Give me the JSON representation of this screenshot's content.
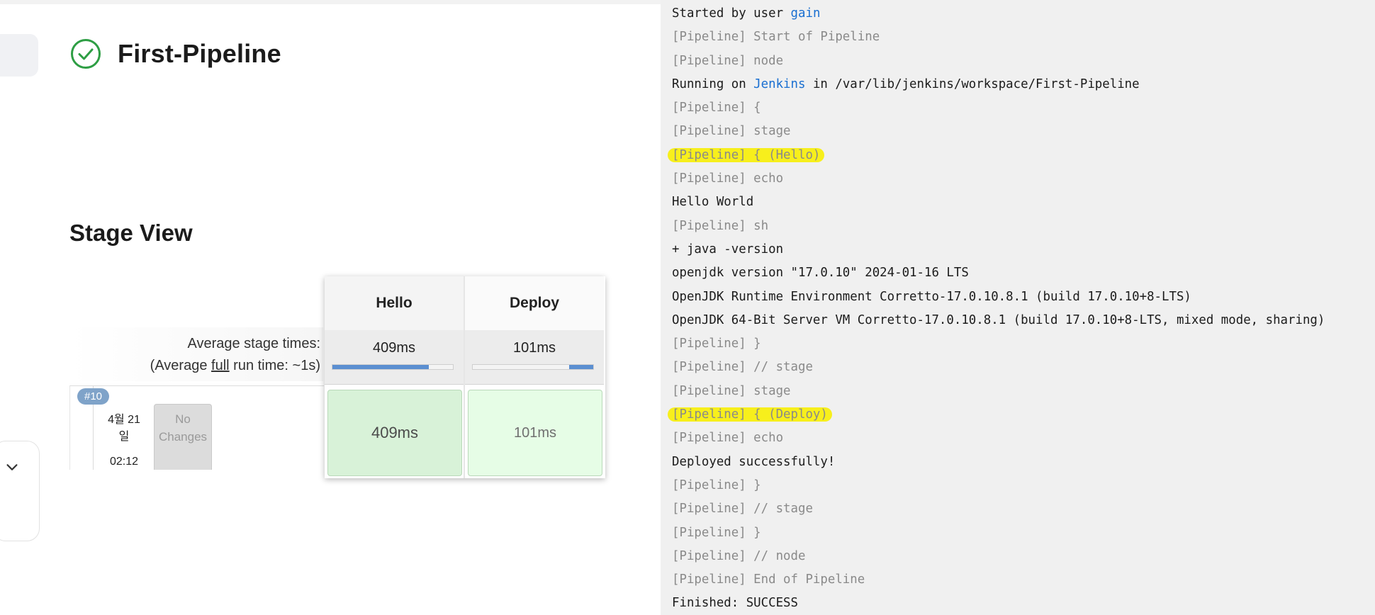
{
  "pipeline": {
    "title": "First-Pipeline",
    "status": "success",
    "status_color": "#2e9e44"
  },
  "stage_view": {
    "title": "Stage View",
    "avg_label_line1": "Average stage times:",
    "avg_label_line2_prefix": "(Average ",
    "avg_label_line2_link": "full",
    "avg_label_line2_suffix": " run time: ~1s)",
    "stages": [
      {
        "name": "Hello",
        "avg": "409ms",
        "bar_fraction": 0.8,
        "cell": "409ms"
      },
      {
        "name": "Deploy",
        "avg": "101ms",
        "bar_fraction": 0.2,
        "cell": "101ms"
      }
    ],
    "build": {
      "number": "#10",
      "date_line1": "4월 21",
      "date_line2": "일",
      "time": "02:12",
      "changes_line1": "No",
      "changes_line2": "Changes"
    }
  },
  "console": {
    "lines": [
      {
        "type": "out",
        "parts": [
          {
            "text": "Started by user "
          },
          {
            "text": "gain",
            "link": true
          }
        ]
      },
      {
        "type": "meta",
        "parts": [
          {
            "text": "[Pipeline] Start of Pipeline"
          }
        ]
      },
      {
        "type": "meta",
        "parts": [
          {
            "text": "[Pipeline] node"
          }
        ]
      },
      {
        "type": "out",
        "parts": [
          {
            "text": "Running on "
          },
          {
            "text": "Jenkins",
            "link": true
          },
          {
            "text": " in /var/lib/jenkins/workspace/First-Pipeline"
          }
        ]
      },
      {
        "type": "meta",
        "parts": [
          {
            "text": "[Pipeline] {"
          }
        ]
      },
      {
        "type": "meta",
        "parts": [
          {
            "text": "[Pipeline] stage"
          }
        ]
      },
      {
        "type": "meta",
        "highlight": true,
        "parts": [
          {
            "text": "[Pipeline] { (Hello)"
          }
        ]
      },
      {
        "type": "meta",
        "parts": [
          {
            "text": "[Pipeline] echo"
          }
        ]
      },
      {
        "type": "out",
        "parts": [
          {
            "text": "Hello World"
          }
        ]
      },
      {
        "type": "meta",
        "parts": [
          {
            "text": "[Pipeline] sh"
          }
        ]
      },
      {
        "type": "out",
        "parts": [
          {
            "text": "+ java -version"
          }
        ]
      },
      {
        "type": "out",
        "parts": [
          {
            "text": "openjdk version \"17.0.10\" 2024-01-16 LTS"
          }
        ]
      },
      {
        "type": "out",
        "parts": [
          {
            "text": "OpenJDK Runtime Environment Corretto-17.0.10.8.1 (build 17.0.10+8-LTS)"
          }
        ]
      },
      {
        "type": "out",
        "parts": [
          {
            "text": "OpenJDK 64-Bit Server VM Corretto-17.0.10.8.1 (build 17.0.10+8-LTS, mixed mode, sharing)"
          }
        ]
      },
      {
        "type": "meta",
        "parts": [
          {
            "text": "[Pipeline] }"
          }
        ]
      },
      {
        "type": "meta",
        "parts": [
          {
            "text": "[Pipeline] // stage"
          }
        ]
      },
      {
        "type": "meta",
        "parts": [
          {
            "text": "[Pipeline] stage"
          }
        ]
      },
      {
        "type": "meta",
        "highlight": true,
        "parts": [
          {
            "text": "[Pipeline] { (Deploy)"
          }
        ]
      },
      {
        "type": "meta",
        "parts": [
          {
            "text": "[Pipeline] echo"
          }
        ]
      },
      {
        "type": "out",
        "parts": [
          {
            "text": "Deployed successfully!"
          }
        ]
      },
      {
        "type": "meta",
        "parts": [
          {
            "text": "[Pipeline] }"
          }
        ]
      },
      {
        "type": "meta",
        "parts": [
          {
            "text": "[Pipeline] // stage"
          }
        ]
      },
      {
        "type": "meta",
        "parts": [
          {
            "text": "[Pipeline] }"
          }
        ]
      },
      {
        "type": "meta",
        "parts": [
          {
            "text": "[Pipeline] // node"
          }
        ]
      },
      {
        "type": "meta",
        "parts": [
          {
            "text": "[Pipeline] End of Pipeline"
          }
        ]
      },
      {
        "type": "out",
        "parts": [
          {
            "text": "Finished: SUCCESS"
          }
        ]
      }
    ]
  }
}
